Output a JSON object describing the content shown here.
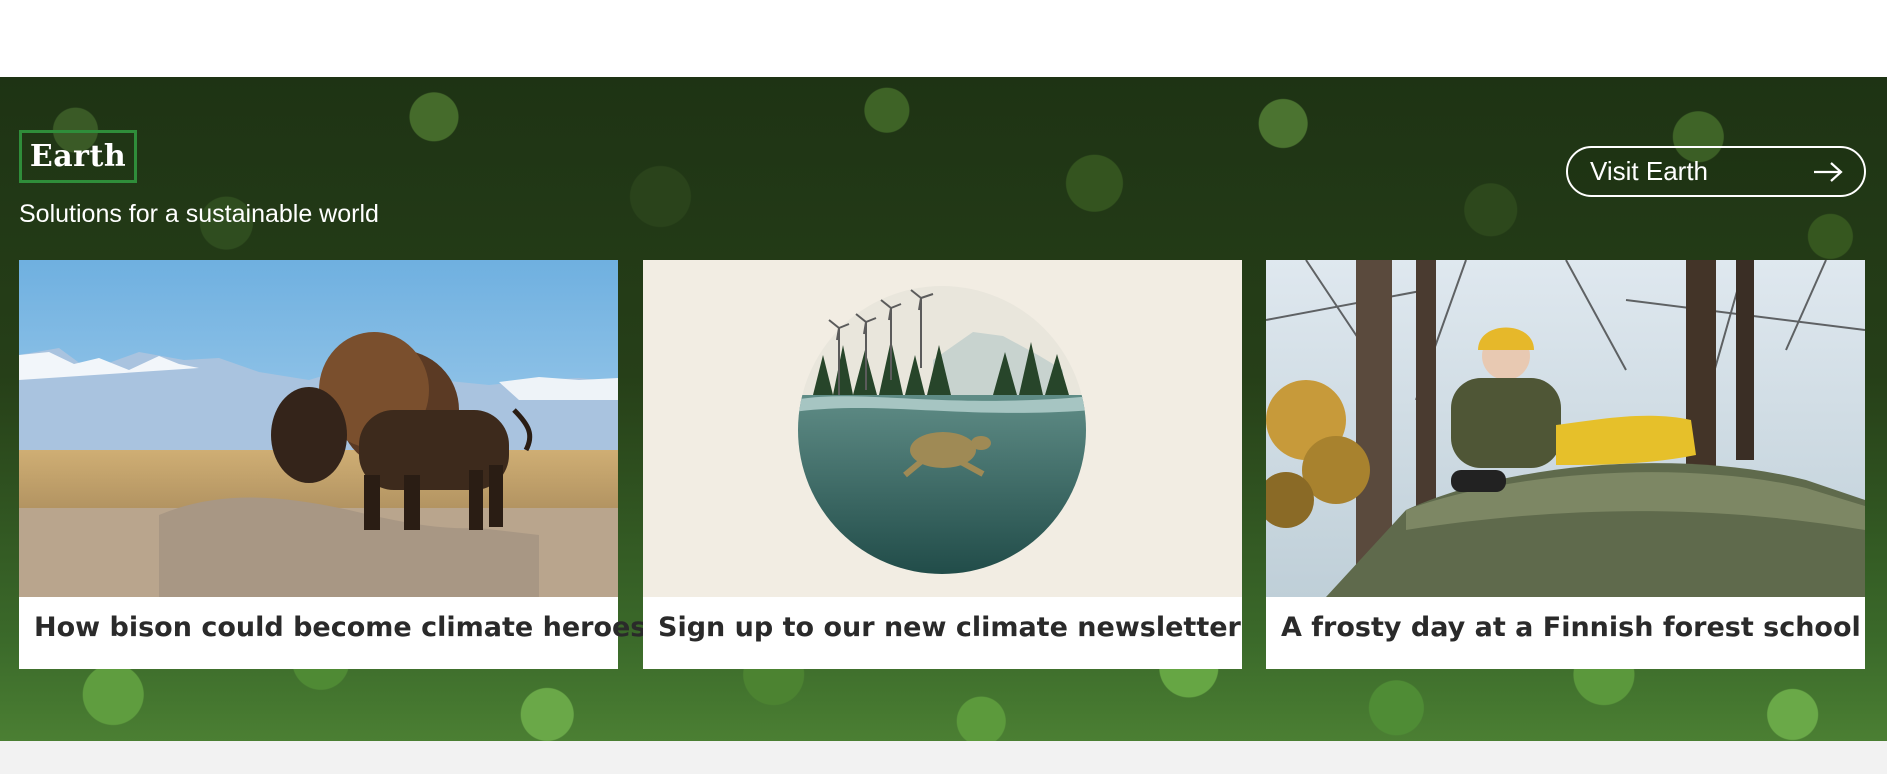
{
  "section": {
    "brand": "Earth",
    "tagline": "Solutions for a sustainable world",
    "visit_button": {
      "label": "Visit Earth",
      "icon": "arrow-right-icon"
    },
    "accent_color": "#2f8d3a"
  },
  "cards": [
    {
      "title": "How bison could become climate heroes"
    },
    {
      "title": "Sign up to our new climate newsletter"
    },
    {
      "title": "A frosty day at a Finnish forest school"
    }
  ]
}
